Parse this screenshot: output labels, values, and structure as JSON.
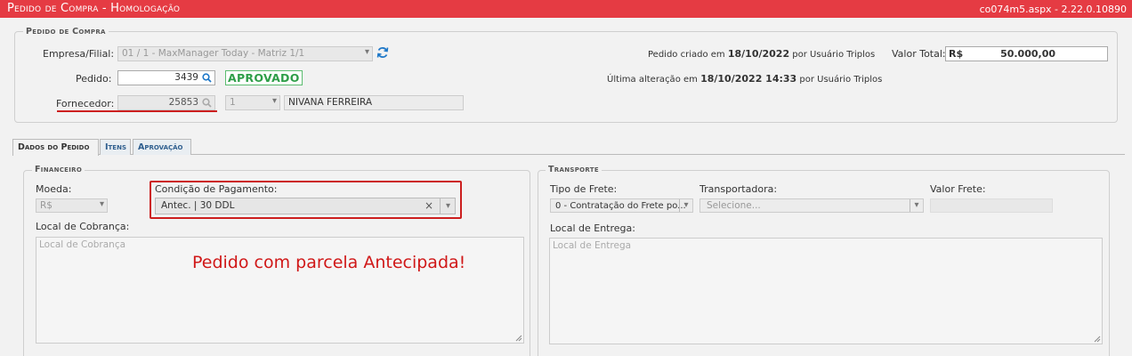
{
  "header": {
    "title": "Pedido de Compra  - Homologação",
    "version": "co074m5.aspx - 2.22.0.10890"
  },
  "pedido_section": {
    "legend": "Pedido de Compra",
    "empresa_label": "Empresa/Filial:",
    "empresa_value": "01 / 1 - MaxManager Today - Matriz 1/1",
    "pedido_label": "Pedido:",
    "pedido_value": "3439",
    "status_badge": "APROVADO",
    "fornecedor_label": "Fornecedor:",
    "fornecedor_code": "25853",
    "fornecedor_select": "1",
    "fornecedor_name": "NIVANA FERREIRA",
    "criado_prefix": "Pedido criado em",
    "criado_date": "18/10/2022",
    "criado_suffix": "por Usuário Triplos",
    "alteracao_prefix": "Última alteração em",
    "alteracao_date": "18/10/2022 14:33",
    "alteracao_suffix": "por Usuário Triplos",
    "valor_total_label": "Valor Total:",
    "valor_total_currency": "R$",
    "valor_total_value": "50.000,00"
  },
  "tabs": [
    {
      "label": "Dados do Pedido",
      "active": true
    },
    {
      "label": "Itens",
      "active": false
    },
    {
      "label": "Aprovação",
      "active": false
    }
  ],
  "financeiro": {
    "legend": "Financeiro",
    "moeda_label": "Moeda:",
    "moeda_value": "R$",
    "condicao_label": "Condição de Pagamento:",
    "condicao_value": "Antec. | 30 DDL",
    "local_cobranca_label": "Local de Cobrança:",
    "local_cobranca_placeholder": "Local de Cobrança"
  },
  "transporte": {
    "legend": "Transporte",
    "tipo_frete_label": "Tipo de Frete:",
    "tipo_frete_value": "0 - Contratação do Frete po...",
    "transportadora_label": "Transportadora:",
    "transportadora_placeholder": "Selecione...",
    "valor_frete_label": "Valor Frete:",
    "local_entrega_label": "Local de Entrega:",
    "local_entrega_placeholder": "Local de Entrega"
  },
  "annotation": {
    "text": "Pedido com parcela Antecipada!",
    "color": "#d01818"
  },
  "colors": {
    "titlebar": "#e53b43",
    "approved": "#2e9e48",
    "link_icon": "#1f78c8"
  }
}
